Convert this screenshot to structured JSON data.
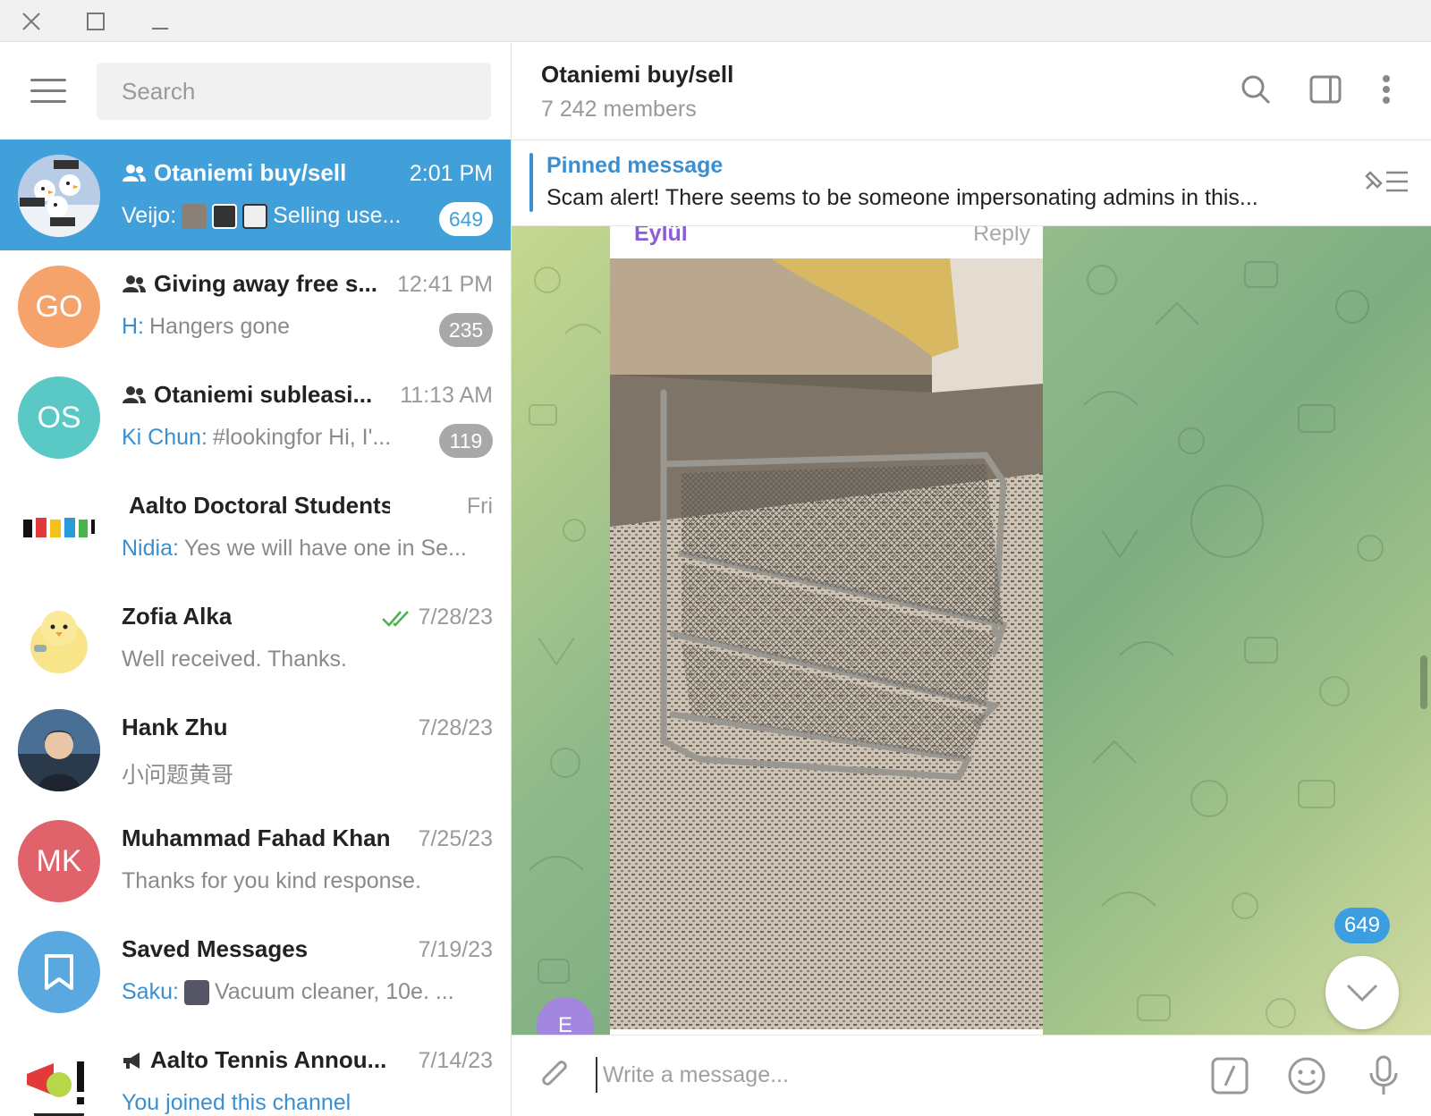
{
  "search": {
    "placeholder": "Search"
  },
  "chats": [
    {
      "name": "Otaniemi buy/sell",
      "time": "2:01 PM",
      "sender": "Veijo:",
      "preview": "Selling use...",
      "badge": "649",
      "is_group": true,
      "active": true
    },
    {
      "name": "Giving away free s...",
      "time": "12:41 PM",
      "sender": "H:",
      "preview": "Hangers gone",
      "badge": "235",
      "is_group": true,
      "avatar_initials": "GO",
      "avatar_color": "#f6a26b"
    },
    {
      "name": "Otaniemi subleasi...",
      "time": "11:13 AM",
      "sender": "Ki Chun:",
      "preview": "#lookingfor  Hi, I'...",
      "badge": "119",
      "is_group": true,
      "avatar_initials": "OS",
      "avatar_color": "#5ac8c4"
    },
    {
      "name": "Aalto Doctoral Students",
      "time": "Fri",
      "sender": "Nidia:",
      "preview": "Yes we will have one in Se...",
      "is_group": true
    },
    {
      "name": "Zofia Alka",
      "time": "7/28/23",
      "preview": "Well received. Thanks.",
      "read": true
    },
    {
      "name": "Hank Zhu",
      "time": "7/28/23",
      "preview": "小问题黄哥"
    },
    {
      "name": "Muhammad Fahad Khan",
      "time": "7/25/23",
      "preview": "Thanks for you kind response.",
      "avatar_initials": "MK",
      "avatar_color": "#e0626b"
    },
    {
      "name": "Saved Messages",
      "time": "7/19/23",
      "sender": "Saku:",
      "preview": "Vacuum cleaner, 10e. ...",
      "avatar_color": "#5aa8e0"
    },
    {
      "name": "Aalto Tennis Annou...",
      "time": "7/14/23",
      "preview": "You joined this channel",
      "is_channel": true
    }
  ],
  "header": {
    "title": "Otaniemi buy/sell",
    "subtitle": "7 242 members"
  },
  "pinned": {
    "label": "Pinned message",
    "text": "Scam alert! There seems to be someone impersonating admins in this..."
  },
  "message": {
    "author": "Eylül",
    "reply_label": "Reply",
    "avatar_initial": "E"
  },
  "unread_badge": "649",
  "composer": {
    "placeholder": "Write a message..."
  },
  "colors": {
    "accent": "#419fd9",
    "author": "#8e5ad7",
    "link": "#3a8fd0"
  }
}
